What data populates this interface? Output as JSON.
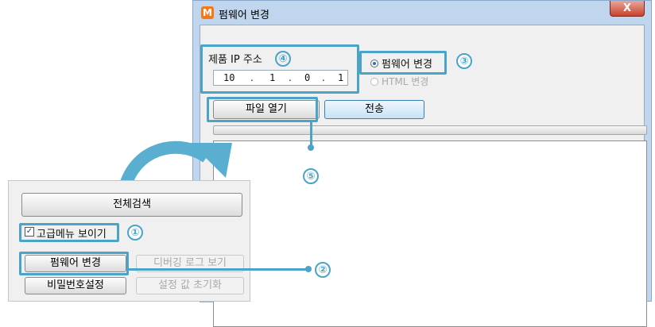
{
  "dialog": {
    "app_icon": "M",
    "title": "펌웨어 변경",
    "close_glyph": "X",
    "ip_label": "제품 IP 주소",
    "ip_octets": [
      "10",
      "1",
      "0",
      "1"
    ],
    "ip_dot": ".",
    "radio_firmware": "펌웨어 변경",
    "radio_html": "HTML 변경",
    "open_file_button": "파일 열기",
    "send_button": "전송"
  },
  "panel": {
    "search_all_button": "전체검색",
    "advanced_menu_checkbox": "고급메뉴 보이기",
    "checkbox_checked_glyph": "✓",
    "firmware_change_button": "펌웨어 변경",
    "debug_log_button": "디버깅 로그 보기",
    "password_setting_button": "비밀번호설정",
    "reset_settings_button": "설정 값 초기화"
  },
  "callouts": [
    "①",
    "②",
    "③",
    "④",
    "⑤"
  ],
  "accent_color": "#4ba4c8"
}
